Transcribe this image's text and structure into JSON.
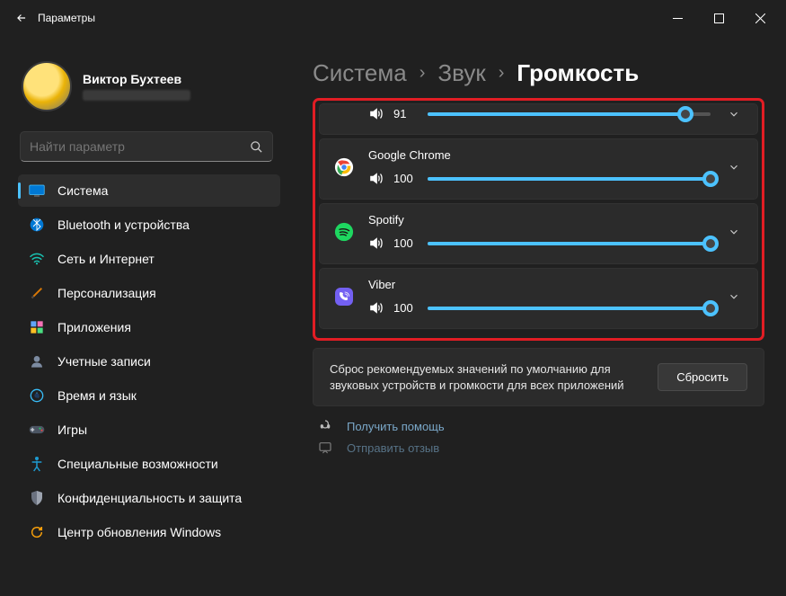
{
  "titlebar": {
    "title": "Параметры"
  },
  "profile": {
    "name": "Виктор Бухтеев"
  },
  "search": {
    "placeholder": "Найти параметр"
  },
  "nav": [
    {
      "key": "system",
      "label": "Система",
      "active": true
    },
    {
      "key": "bluetooth",
      "label": "Bluetooth и устройства"
    },
    {
      "key": "network",
      "label": "Сеть и Интернет"
    },
    {
      "key": "personal",
      "label": "Персонализация"
    },
    {
      "key": "apps",
      "label": "Приложения"
    },
    {
      "key": "accounts",
      "label": "Учетные записи"
    },
    {
      "key": "time",
      "label": "Время и язык"
    },
    {
      "key": "games",
      "label": "Игры"
    },
    {
      "key": "access",
      "label": "Специальные возможности"
    },
    {
      "key": "privacy",
      "label": "Конфиденциальность и защита"
    },
    {
      "key": "update",
      "label": "Центр обновления Windows"
    }
  ],
  "breadcrumb": {
    "c1": "Система",
    "c2": "Звук",
    "c3": "Громкость"
  },
  "apps": [
    {
      "name": "",
      "value": 91,
      "icon": "generic"
    },
    {
      "name": "Google Chrome",
      "value": 100,
      "icon": "chrome"
    },
    {
      "name": "Spotify",
      "value": 100,
      "icon": "spotify"
    },
    {
      "name": "Viber",
      "value": 100,
      "icon": "viber"
    }
  ],
  "reset": {
    "text": "Сброс рекомендуемых значений по умолчанию для звуковых устройств и громкости для всех приложений",
    "button": "Сбросить"
  },
  "help": {
    "label": "Получить помощь"
  },
  "feedback": {
    "label": "Отправить отзыв"
  }
}
